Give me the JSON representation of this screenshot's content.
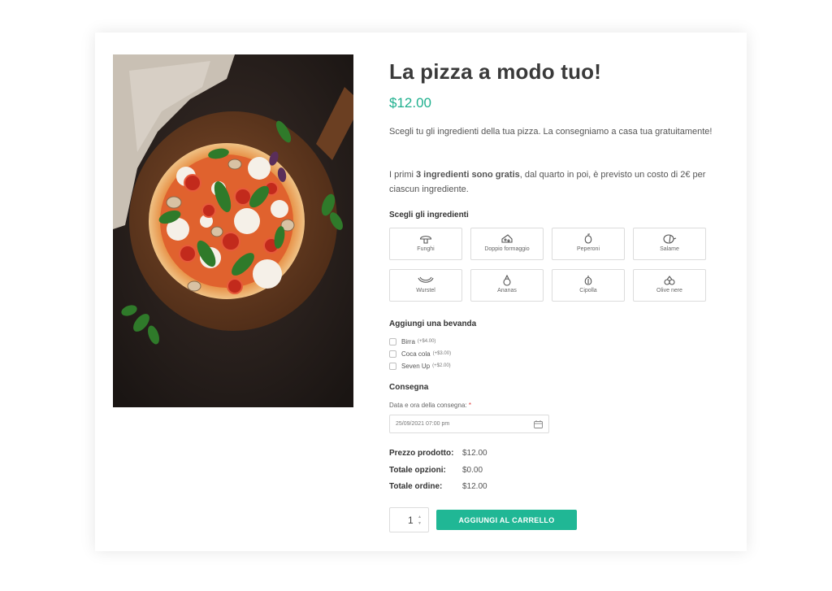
{
  "product": {
    "title": "La pizza a modo tuo!",
    "price": "$12.00",
    "description_1": "Scegli tu gli ingredienti della tua pizza. La consegniamo a casa tua gratuitamente!",
    "description_2_prefix": "I primi ",
    "description_2_bold": "3 ingredienti sono gratis",
    "description_2_suffix": ", dal quarto in poi, è previsto un costo di 2€ per ciascun ingrediente."
  },
  "ingredients": {
    "heading": "Scegli gli ingredienti",
    "items": [
      {
        "label": "Funghi",
        "icon": "mushroom-icon"
      },
      {
        "label": "Doppio formaggio",
        "icon": "cheese-icon"
      },
      {
        "label": "Peperoni",
        "icon": "pepper-icon"
      },
      {
        "label": "Salame",
        "icon": "salami-icon"
      },
      {
        "label": "Wurstel",
        "icon": "sausage-icon"
      },
      {
        "label": "Ananas",
        "icon": "pineapple-icon"
      },
      {
        "label": "Cipolla",
        "icon": "onion-icon"
      },
      {
        "label": "Olive nere",
        "icon": "olives-icon"
      }
    ]
  },
  "drinks": {
    "heading": "Aggiungi una bevanda",
    "items": [
      {
        "label": "Birra",
        "extra": "(+$4.00)"
      },
      {
        "label": "Coca cola",
        "extra": "(+$3.00)"
      },
      {
        "label": "Seven Up",
        "extra": "(+$2.00)"
      }
    ]
  },
  "delivery": {
    "heading": "Consegna",
    "date_label": "Data e ora della consegna:",
    "required_mark": "*",
    "date_value": "25/09/2021 07:00 pm"
  },
  "totals": [
    {
      "label": "Prezzo prodotto:",
      "value": "$12.00"
    },
    {
      "label": "Totale opzioni:",
      "value": "$0.00"
    },
    {
      "label": "Totale ordine:",
      "value": "$12.00"
    }
  ],
  "cart": {
    "quantity": "1",
    "button_label": "AGGIUNGI AL CARRELLO"
  },
  "colors": {
    "accent": "#1fb08e",
    "button": "#20b795"
  }
}
